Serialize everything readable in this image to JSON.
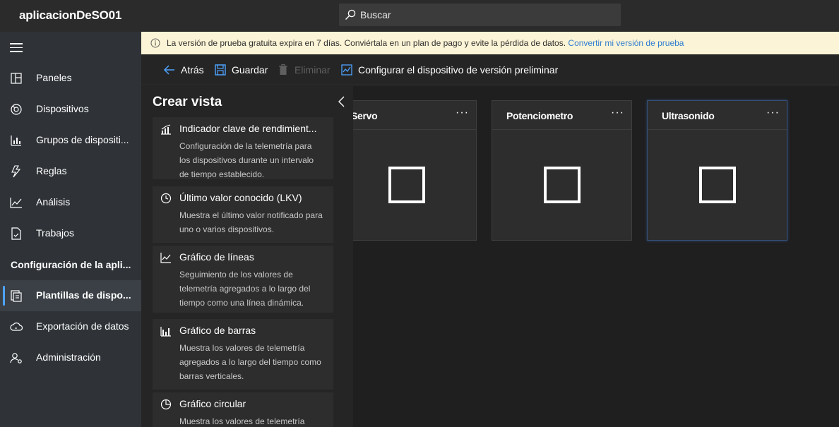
{
  "app": {
    "title": "aplicacionDeSO01"
  },
  "search": {
    "placeholder": "Buscar"
  },
  "sidebar": {
    "items": [
      {
        "label": "Paneles",
        "icon": "dashboard-icon"
      },
      {
        "label": "Dispositivos",
        "icon": "devices-icon"
      },
      {
        "label": "Grupos de dispositi...",
        "icon": "device-groups-icon"
      },
      {
        "label": "Reglas",
        "icon": "rules-icon"
      },
      {
        "label": "Análisis",
        "icon": "analytics-icon"
      },
      {
        "label": "Trabajos",
        "icon": "jobs-icon"
      }
    ],
    "section_label": "Configuración de la apli...",
    "config_items": [
      {
        "label": "Plantillas de dispo...",
        "icon": "device-templates-icon",
        "active": true
      },
      {
        "label": "Exportación de datos",
        "icon": "data-export-icon"
      },
      {
        "label": "Administración",
        "icon": "administration-icon"
      }
    ]
  },
  "banner": {
    "text": "La versión de prueba gratuita expira en 7 días. Conviértala en un plan de pago y evite la pérdida de datos.",
    "link": "Convertir mi versión de prueba",
    "background": "#fcf4d6"
  },
  "toolbar": {
    "back_label": "Atrás",
    "save_label": "Guardar",
    "delete_label": "Eliminar",
    "configure_label": "Configurar el dispositivo de versión preliminar"
  },
  "panel": {
    "title": "Crear vista",
    "cards": [
      {
        "title": "Indicador clave de rendimient...",
        "desc": "Configuración de la telemetría para los dispositivos durante un intervalo de tiempo establecido.",
        "icon": "kpi-icon"
      },
      {
        "title": "Último valor conocido (LKV)",
        "desc": "Muestra el último valor notificado para uno o varios dispositivos.",
        "icon": "clock-icon"
      },
      {
        "title": "Gráfico de líneas",
        "desc": "Seguimiento de los valores de telemetría agregados a lo largo del tiempo como una línea dinámica.",
        "icon": "line-chart-icon"
      },
      {
        "title": "Gráfico de barras",
        "desc": "Muestra los valores de telemetría agregados a lo largo del tiempo como barras verticales.",
        "icon": "bar-chart-icon"
      },
      {
        "title": "Gráfico circular",
        "desc": "Muestra los valores de telemetría",
        "icon": "pie-chart-icon"
      }
    ]
  },
  "tiles": [
    {
      "title": "Servo",
      "more": "···"
    },
    {
      "title": "Potenciometro",
      "more": "···"
    },
    {
      "title": "Ultrasonido",
      "more": "···",
      "selected": true
    }
  ],
  "colors": {
    "accent": "#4ea3ff",
    "link": "#2f7dd1",
    "sidebar": "#2f3338"
  }
}
